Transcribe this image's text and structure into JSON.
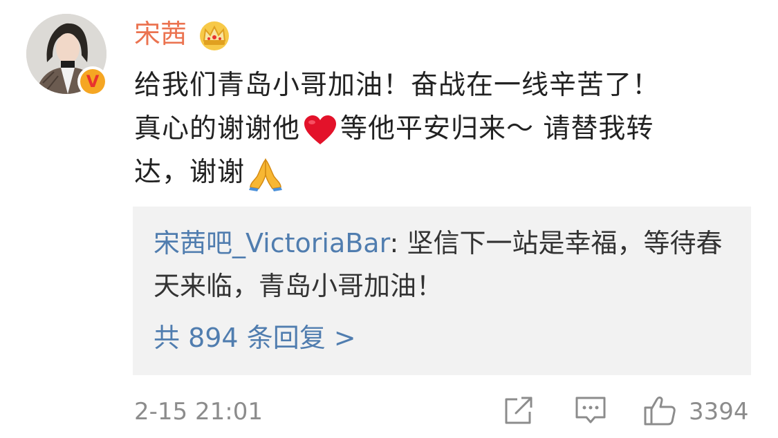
{
  "comment": {
    "author": {
      "name": "宋茜",
      "verified_badge": "V",
      "crown_icon": "crown-icon",
      "avatar_icon": "avatar"
    },
    "content": {
      "line1": "给我们青岛小哥加油！奋战在一线辛苦了！",
      "line2_a": "真心的谢谢他",
      "line2_b": "等他平安归来～ 请替我转",
      "line3": "达，谢谢",
      "emoji_heart": "red-heart-icon",
      "emoji_pray": "folded-hands-icon"
    },
    "reply_preview": {
      "user": "宋茜吧_VictoriaBar",
      "separator": ": ",
      "text": "坚信下一站是幸福，等待春天来临，青岛小哥加油！",
      "more_label": "共 894 条回复 >"
    },
    "footer": {
      "timestamp": "2-15 21:01",
      "like_count": "3394",
      "share_icon": "share-icon",
      "comment_icon": "comment-icon",
      "like_icon": "thumbs-up-icon"
    }
  },
  "colors": {
    "username": "#eb7350",
    "link": "#507daf",
    "body_text": "#222222",
    "meta_text": "#8c8c8c",
    "reply_bg": "#f2f2f2",
    "badge_bg": "#f5a623",
    "badge_v": "#e8322e"
  }
}
